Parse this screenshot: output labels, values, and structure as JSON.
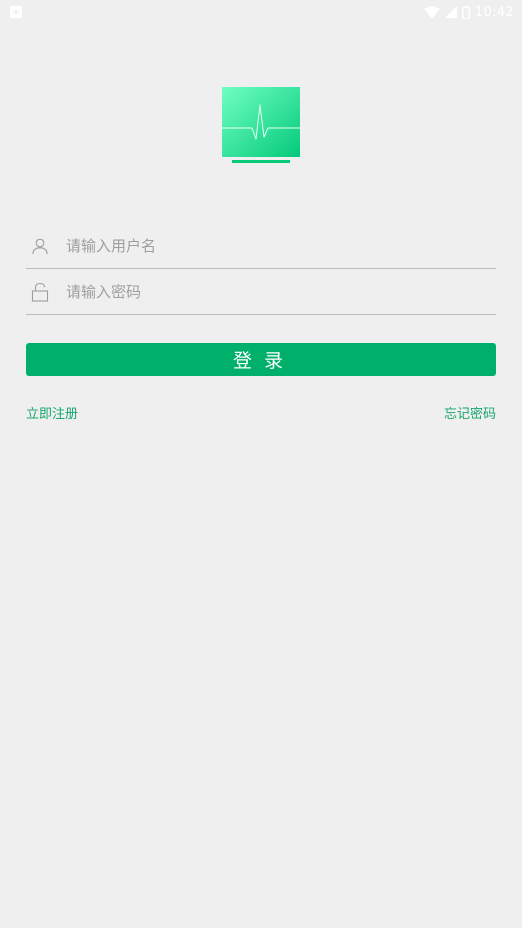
{
  "status_bar": {
    "time": "10:42",
    "icons": [
      "notification-icon",
      "wifi-icon",
      "signal-icon",
      "battery-icon"
    ]
  },
  "logo": {
    "icon": "heart-monitor-icon",
    "colors": {
      "top": "#6fffc4",
      "bottom": "#05c97a"
    }
  },
  "login_form": {
    "username": {
      "icon": "user-icon",
      "placeholder": "请输入用户名",
      "value": ""
    },
    "password": {
      "icon": "lock-icon",
      "placeholder": "请输入密码",
      "value": ""
    }
  },
  "login_button": {
    "label": "登录",
    "color": "#00b06a"
  },
  "links": {
    "register": "立即注册",
    "forgot_password": "忘记密码",
    "color": "#14a86a"
  }
}
